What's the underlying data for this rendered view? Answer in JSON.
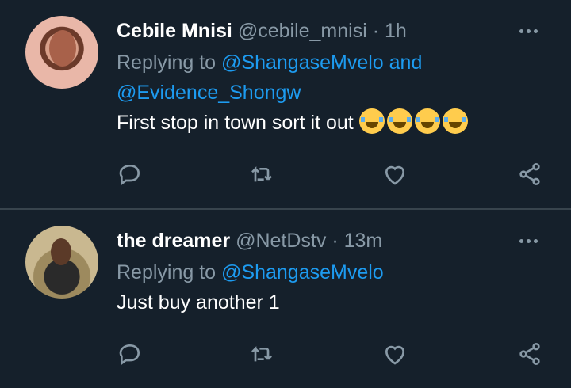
{
  "tweets": [
    {
      "name": "Cebile Mnisi",
      "handle": "@cebile_mnisi",
      "separator": "·",
      "time": "1h",
      "replying_prefix": "Replying to",
      "replying_to_1": "@ShangaseMvelo",
      "replying_join": "and",
      "replying_to_2": "@Evidence_Shongw",
      "text": "First stop in town sort it out",
      "emoji_names": [
        "face-with-tears-of-joy",
        "face-with-tears-of-joy",
        "face-with-tears-of-joy",
        "face-with-tears-of-joy"
      ]
    },
    {
      "name": "the dreamer",
      "handle": "@NetDstv",
      "separator": "·",
      "time": "13m",
      "replying_prefix": "Replying to",
      "replying_to_1": "@ShangaseMvelo",
      "text": "Just buy another 1"
    }
  ],
  "icons": {
    "reply": "reply-icon",
    "retweet": "retweet-icon",
    "like": "heart-icon",
    "share": "share-icon",
    "more": "more-icon"
  },
  "colors": {
    "background": "#15202b",
    "text": "#ffffff",
    "secondary": "#8899a6",
    "link": "#1d9bf0",
    "divider": "#38444d"
  }
}
